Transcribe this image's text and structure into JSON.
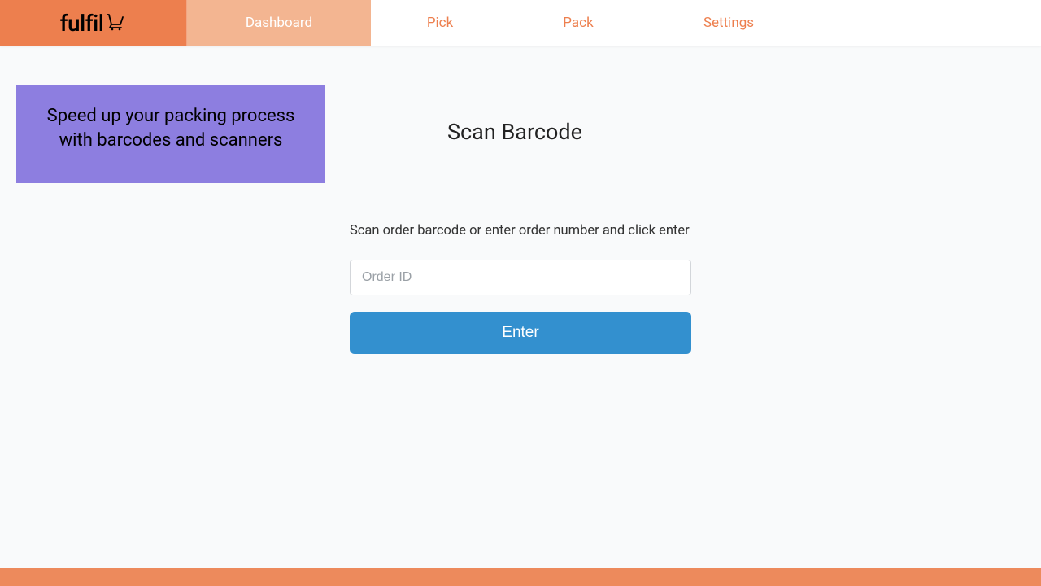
{
  "brand": {
    "name": "fulfil"
  },
  "nav": {
    "items": [
      {
        "label": "Dashboard",
        "active": true
      },
      {
        "label": "Pick",
        "active": false
      },
      {
        "label": "Pack",
        "active": false
      },
      {
        "label": "Settings",
        "active": false
      }
    ]
  },
  "promo": {
    "line": "Speed up your packing process with barcodes and scanners"
  },
  "main": {
    "title": "Scan Barcode",
    "instruction": "Scan order barcode or enter order number and click enter",
    "input_placeholder": "Order ID",
    "button_label": "Enter"
  },
  "footer": {
    "text": ""
  },
  "colors": {
    "brand_orange": "#ed7f4e",
    "nav_active_bg": "#f3b591",
    "promo_bg": "#8d7ee0",
    "button_bg": "#3390cf"
  }
}
